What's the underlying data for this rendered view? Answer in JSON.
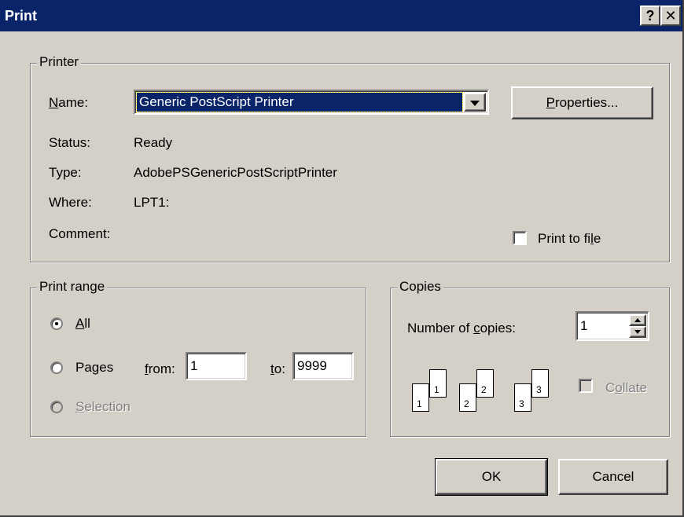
{
  "window": {
    "title": "Print",
    "help_glyph": "?",
    "close_glyph": "✕"
  },
  "printer": {
    "group_label": "Printer",
    "name_label": "Name:",
    "name_value": "Generic PostScript Printer",
    "properties_label": "Properties...",
    "status_label": "Status:",
    "status_value": "Ready",
    "type_label": "Type:",
    "type_value": "AdobePSGenericPostScriptPrinter",
    "where_label": "Where:",
    "where_value": "LPT1:",
    "comment_label": "Comment:",
    "print_to_file_label": "Print to file",
    "print_to_file_checked": false
  },
  "print_range": {
    "group_label": "Print range",
    "all_label": "All",
    "pages_label": "Pages",
    "from_label": "from:",
    "from_value": "1",
    "to_label": "to:",
    "to_value": "9999",
    "selection_label": "Selection",
    "selected": "all"
  },
  "copies": {
    "group_label": "Copies",
    "number_label": "Number of copies:",
    "number_value": "1",
    "collate_label": "Collate",
    "collate_checked": false,
    "page_numbers": [
      "1",
      "1",
      "2",
      "2",
      "3",
      "3"
    ]
  },
  "buttons": {
    "ok_label": "OK",
    "cancel_label": "Cancel"
  },
  "colors": {
    "title_bar": "#0a246a",
    "dialog_face": "#d4d0c8",
    "selection_highlight": "#0a246a"
  }
}
